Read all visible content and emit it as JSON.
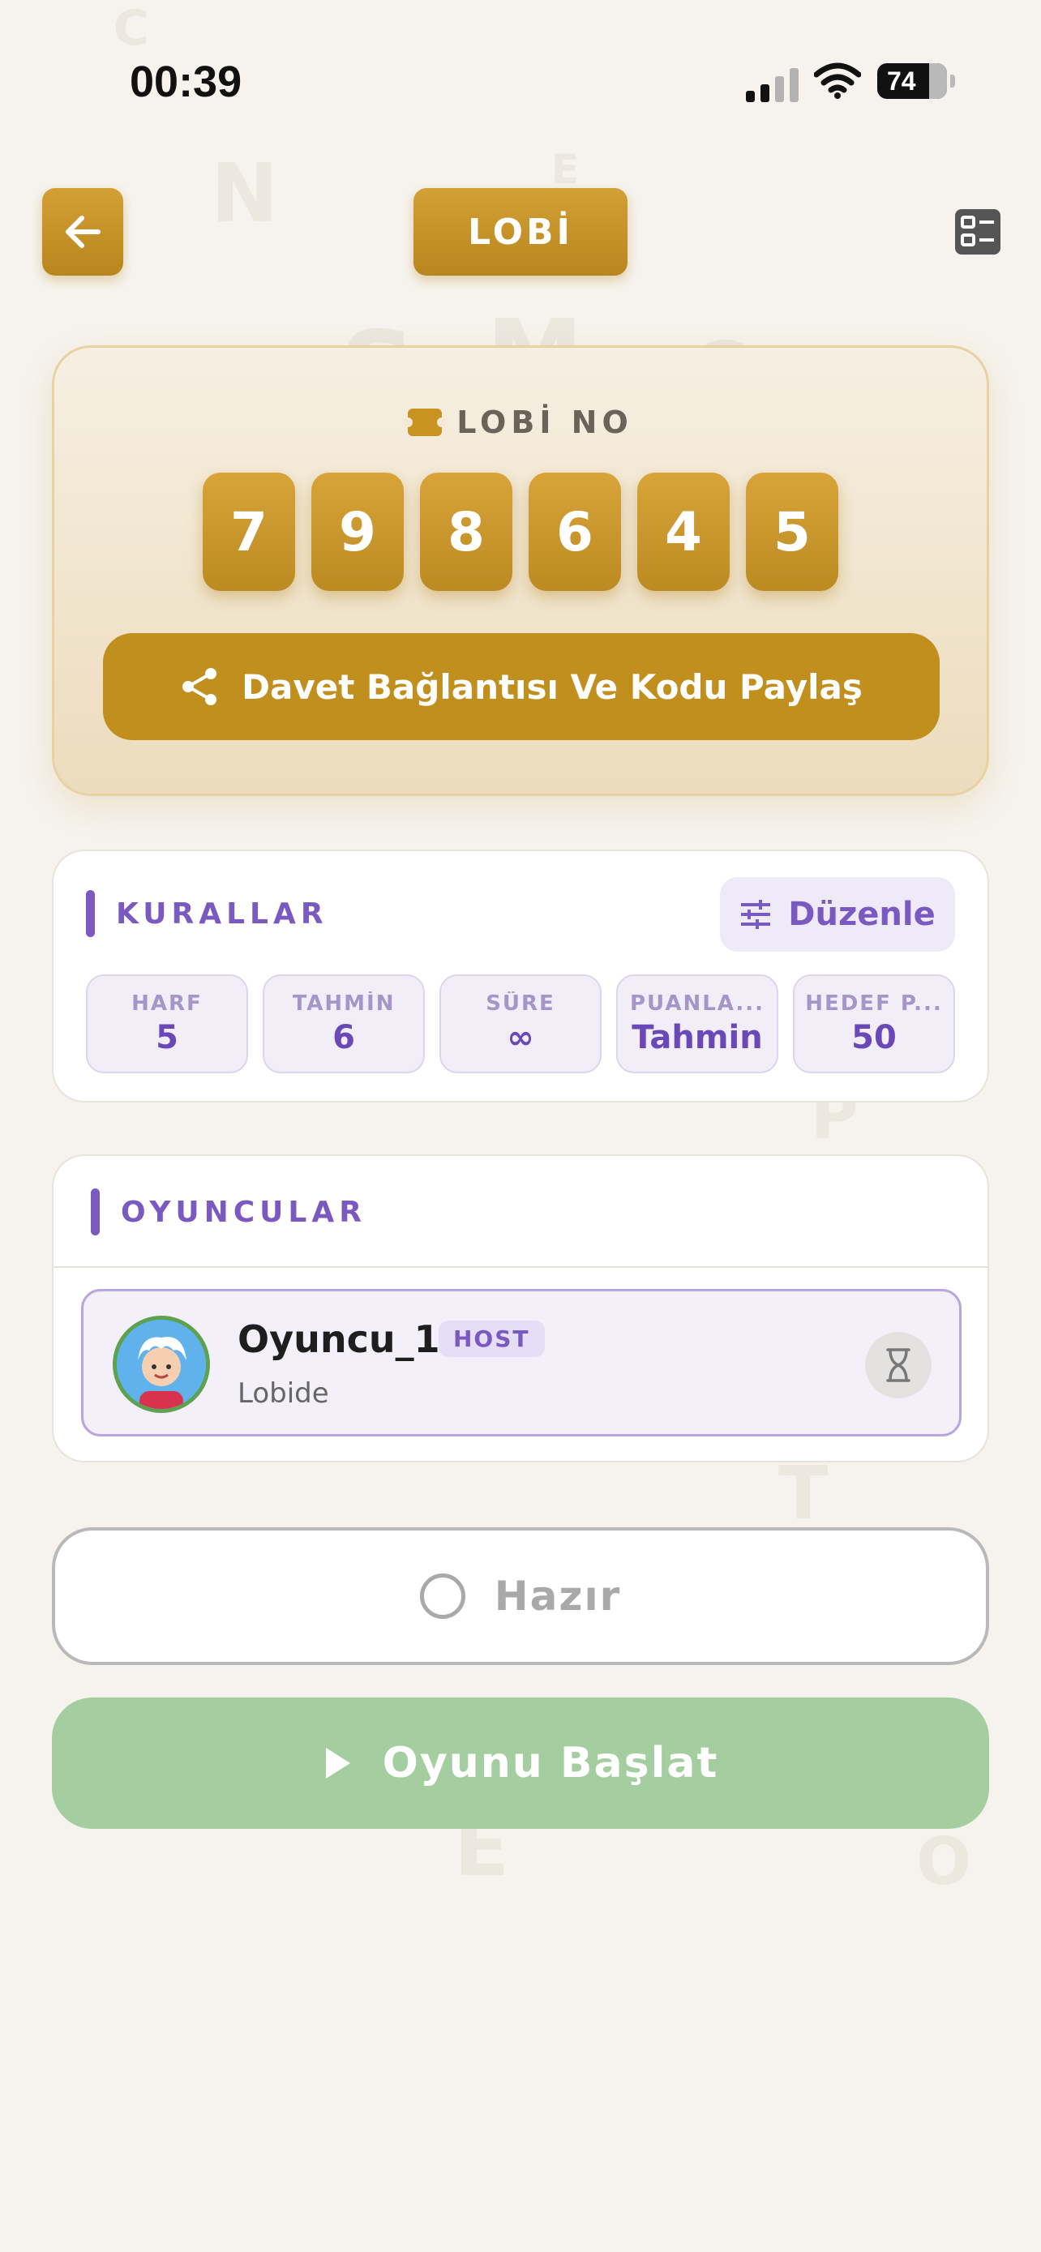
{
  "status_bar": {
    "time": "00:39",
    "battery": "74",
    "icons": [
      "signal-icon",
      "wifi-icon",
      "battery-icon"
    ]
  },
  "header": {
    "title": "LOBİ",
    "back_icon": "arrow-left-icon",
    "menu_icon": "list-layout-icon"
  },
  "lobby": {
    "label": "LOBİ NO",
    "code_digits": [
      "7",
      "9",
      "8",
      "6",
      "4",
      "5"
    ],
    "share_label": "Davet Bağlantısı Ve Kodu Paylaş"
  },
  "rules": {
    "title": "KURALLAR",
    "edit_label": "Düzenle",
    "items": [
      {
        "label": "HARF",
        "value": "5"
      },
      {
        "label": "TAHMİN",
        "value": "6"
      },
      {
        "label": "SÜRE",
        "value": "∞"
      },
      {
        "label": "PUANLA...",
        "value": "Tahmin"
      },
      {
        "label": "HEDEF P...",
        "value": "50"
      }
    ]
  },
  "players": {
    "title": "OYUNCULAR",
    "list": [
      {
        "name": "Oyuncu_1",
        "badge": "HOST",
        "status": "Lobide"
      }
    ]
  },
  "actions": {
    "ready_label": "Hazır",
    "start_label": "Oyunu Başlat"
  },
  "colors": {
    "gold": "#c08f1d",
    "purple": "#7a5ac0",
    "green": "#a5cea0",
    "background": "#f6f3ee"
  }
}
